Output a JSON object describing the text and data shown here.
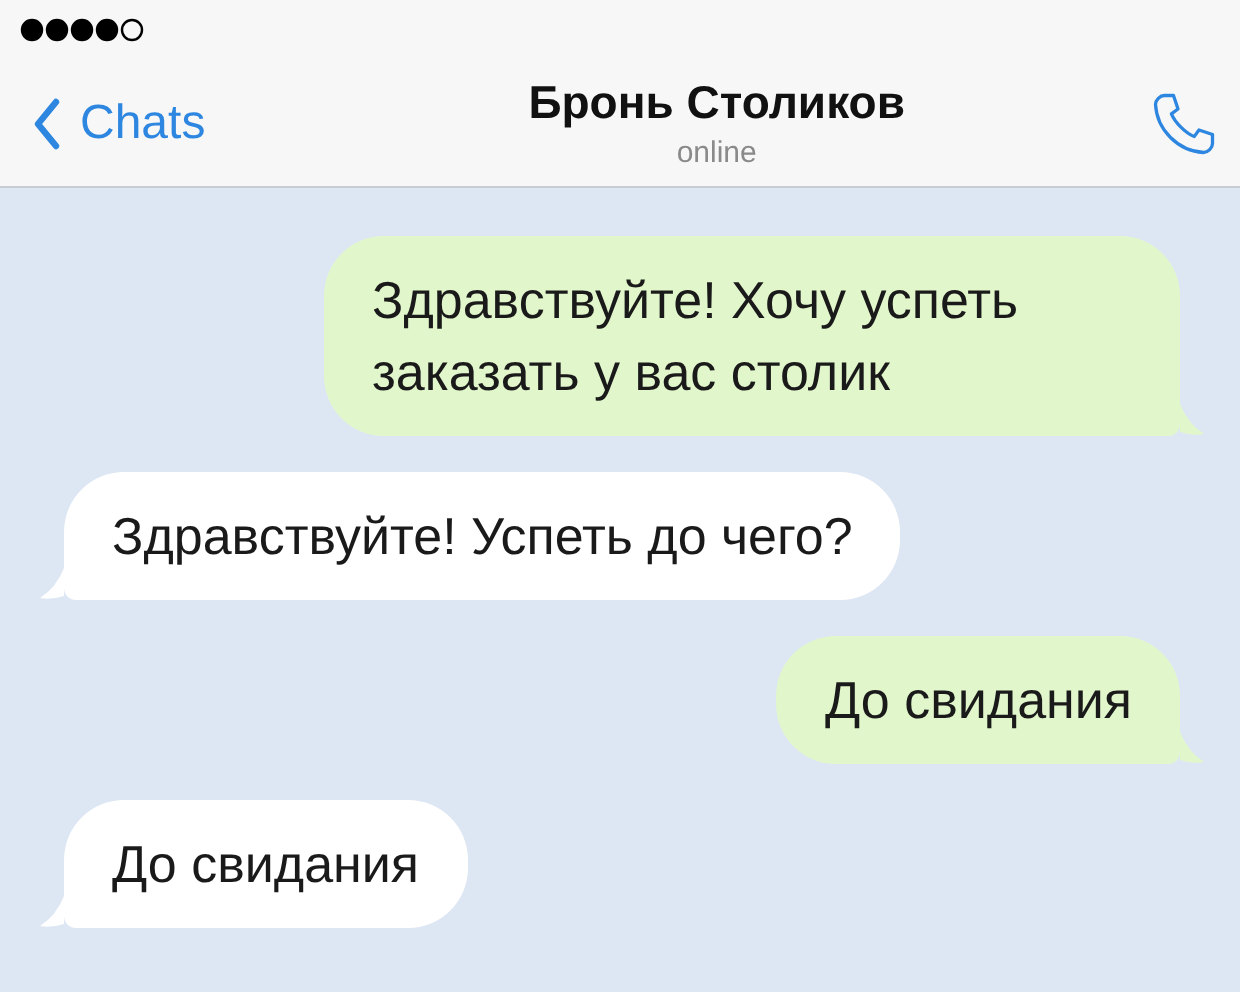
{
  "header": {
    "back_label": "Chats",
    "title": "Бронь Столиков",
    "status": "online"
  },
  "messages": [
    {
      "kind": "outgoing",
      "text": "Здравствуйте! Хочу успеть заказать у вас столик"
    },
    {
      "kind": "incoming",
      "text": "Здравствуйте! Успеть до чего?"
    },
    {
      "kind": "outgoing",
      "text": "До свидания"
    },
    {
      "kind": "incoming",
      "text": "До свидания"
    }
  ]
}
